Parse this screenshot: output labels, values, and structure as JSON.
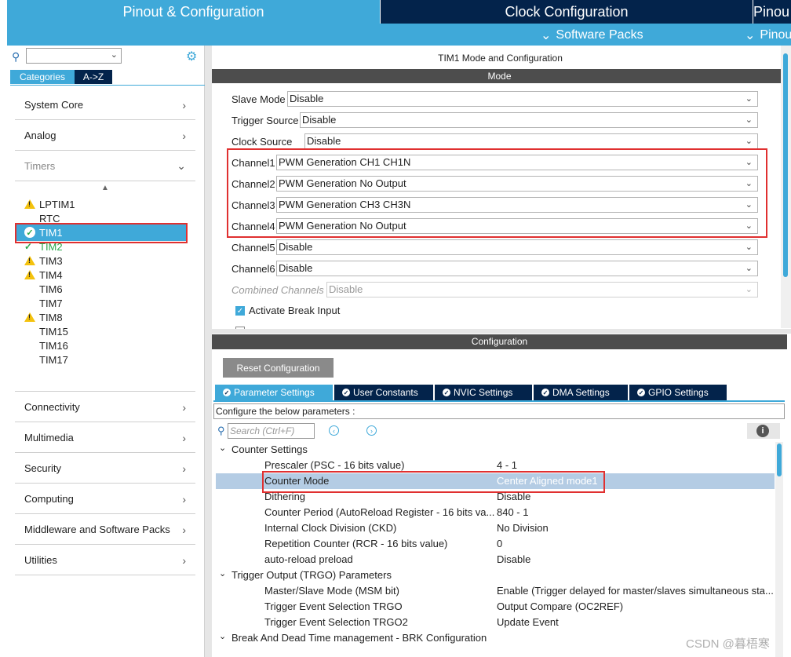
{
  "top_tabs": {
    "pinout": "Pinout & Configuration",
    "clock": "Clock Configuration",
    "pinout_partial": "Pinou"
  },
  "sub_bar": {
    "software_packs": "Software Packs",
    "pinout": "Pinou"
  },
  "left": {
    "tabs": {
      "categories": "Categories",
      "az": "A->Z"
    },
    "categories": [
      {
        "label": "System Core"
      },
      {
        "label": "Analog"
      },
      {
        "label": "Timers"
      },
      {
        "label": "Connectivity"
      },
      {
        "label": "Multimedia"
      },
      {
        "label": "Security"
      },
      {
        "label": "Computing"
      },
      {
        "label": "Middleware and Software Packs"
      },
      {
        "label": "Utilities"
      }
    ],
    "timers": [
      {
        "label": "LPTIM1",
        "icon": "warning-icon"
      },
      {
        "label": "RTC",
        "icon": ""
      },
      {
        "label": "TIM1",
        "icon": "check-circle-icon"
      },
      {
        "label": "TIM2",
        "icon": "check-icon"
      },
      {
        "label": "TIM3",
        "icon": "warning-icon"
      },
      {
        "label": "TIM4",
        "icon": "warning-icon"
      },
      {
        "label": "TIM6",
        "icon": ""
      },
      {
        "label": "TIM7",
        "icon": ""
      },
      {
        "label": "TIM8",
        "icon": "warning-icon"
      },
      {
        "label": "TIM15",
        "icon": ""
      },
      {
        "label": "TIM16",
        "icon": ""
      },
      {
        "label": "TIM17",
        "icon": ""
      }
    ]
  },
  "mode_panel": {
    "title": "TIM1 Mode and Configuration",
    "mode_header": "Mode",
    "rows": [
      {
        "label": "Slave Mode",
        "value": "Disable"
      },
      {
        "label": "Trigger Source",
        "value": "Disable"
      },
      {
        "label": "Clock Source",
        "value": "Disable"
      },
      {
        "label": "Channel1",
        "value": "PWM Generation CH1 CH1N"
      },
      {
        "label": "Channel2",
        "value": "PWM Generation No Output"
      },
      {
        "label": "Channel3",
        "value": "PWM Generation CH3 CH3N"
      },
      {
        "label": "Channel4",
        "value": "PWM Generation No Output"
      },
      {
        "label": "Channel5",
        "value": "Disable"
      },
      {
        "label": "Channel6",
        "value": "Disable"
      },
      {
        "label": "Combined Channels",
        "value": "Disable"
      }
    ],
    "break_input": "Activate Break Input"
  },
  "config_panel": {
    "header": "Configuration",
    "reset_button": "Reset Configuration",
    "tabs": [
      "Parameter Settings",
      "User Constants",
      "NVIC Settings",
      "DMA Settings",
      "GPIO Settings"
    ],
    "configure_text": "Configure the below parameters :",
    "search_placeholder": "Search (Ctrl+F)",
    "groups": [
      {
        "name": "Counter Settings",
        "params": [
          {
            "name": "Prescaler (PSC - 16 bits value)",
            "value": "4 - 1"
          },
          {
            "name": "Counter Mode",
            "value": "Center Aligned mode1"
          },
          {
            "name": "Dithering",
            "value": "Disable"
          },
          {
            "name": "Counter Period (AutoReload Register - 16 bits va...",
            "value": "840 - 1"
          },
          {
            "name": "Internal Clock Division (CKD)",
            "value": "No Division"
          },
          {
            "name": "Repetition Counter (RCR - 16 bits value)",
            "value": "0"
          },
          {
            "name": "auto-reload preload",
            "value": "Disable"
          }
        ]
      },
      {
        "name": "Trigger Output (TRGO) Parameters",
        "params": [
          {
            "name": "Master/Slave Mode (MSM bit)",
            "value": "Enable (Trigger delayed for master/slaves simultaneous sta..."
          },
          {
            "name": "Trigger Event Selection TRGO",
            "value": "Output Compare (OC2REF)"
          },
          {
            "name": "Trigger Event Selection TRGO2",
            "value": "Update Event"
          }
        ]
      },
      {
        "name": "Break And Dead Time management - BRK Configuration",
        "params": []
      }
    ]
  },
  "watermark": "CSDN @暮梧寒",
  "colors": {
    "accent": "#3fa9d9",
    "dark": "#03234b",
    "highlight_red": "#e03030",
    "selected_row": "#b4cce4"
  }
}
